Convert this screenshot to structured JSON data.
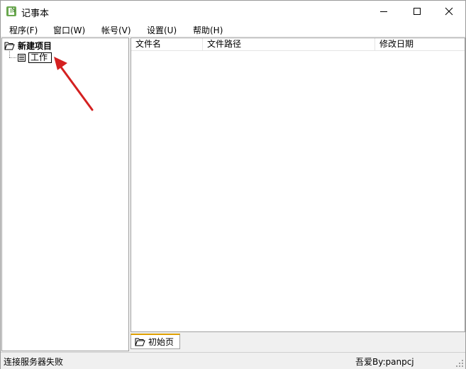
{
  "window": {
    "title": "记事本",
    "minimize_label": "minimize",
    "maximize_label": "maximize",
    "close_label": "close"
  },
  "menu": [
    {
      "label": "程序(F)"
    },
    {
      "label": "窗口(W)"
    },
    {
      "label": "帐号(V)"
    },
    {
      "label": "设置(U)"
    },
    {
      "label": "帮助(H)"
    }
  ],
  "tree": {
    "root_label": "新建项目",
    "child_label": "工作"
  },
  "list": {
    "columns": [
      "文件名",
      "文件路径",
      "修改日期"
    ]
  },
  "tabs": [
    {
      "label": "初始页"
    }
  ],
  "status": {
    "left": "连接服务器失败",
    "right": "吾爱By:panpcj"
  },
  "colors": {
    "annotation_arrow": "#d42020",
    "tab_accent": "#e0a000",
    "app_icon": "#6aa84f"
  }
}
